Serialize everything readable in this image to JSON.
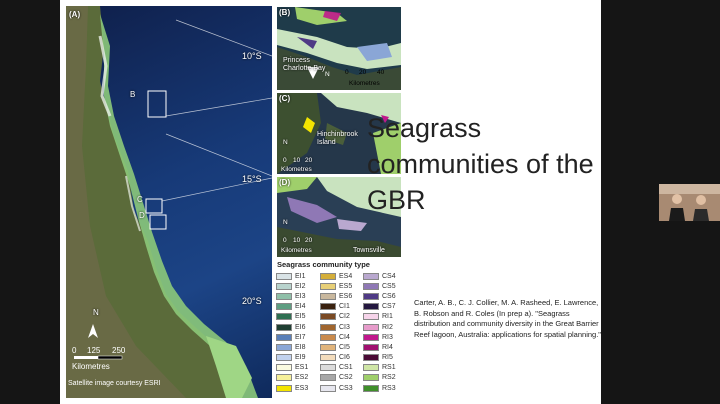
{
  "slide": {
    "title": "Seagrass communities of the GBR",
    "citation": "Carter, A. B., C. J. Collier, M. A. Rasheed, E. Lawrence, B. Robson and R. Coles (In prep a). \"Seagrass distribution and community diversity in the Great Barrier Reef lagoon, Australia: applications for spatial planning.\""
  },
  "figure": {
    "panel_a": {
      "label": "(A)",
      "latitudes": [
        "10°S",
        "15°S",
        "20°S"
      ],
      "box_labels": [
        "B",
        "C",
        "D"
      ],
      "scale_ticks": [
        "0",
        "125",
        "250"
      ],
      "scale_unit": "Kilometres",
      "credit": "Satellite image courtesy ESRI",
      "north": "N"
    },
    "panel_b": {
      "label": "(B)",
      "place": "Princess Charlotte Bay",
      "scale_ticks": [
        "0",
        "20",
        "40"
      ],
      "scale_unit": "Kilometres",
      "north": "N"
    },
    "panel_c": {
      "label": "(C)",
      "place": "Hinchinbrook Island",
      "scale_ticks": [
        "0",
        "10",
        "20"
      ],
      "scale_unit": "Kilometres",
      "north": "N"
    },
    "panel_d": {
      "label": "(D)",
      "place": "Townsville",
      "scale_ticks": [
        "0",
        "10",
        "20"
      ],
      "scale_unit": "Kilometres",
      "north": "N"
    }
  },
  "legend": {
    "title": "Seagrass community type",
    "columns": [
      [
        {
          "label": "EI1",
          "color": "#d9e3e6"
        },
        {
          "label": "EI2",
          "color": "#b8d3cd"
        },
        {
          "label": "EI3",
          "color": "#8fbfa8"
        },
        {
          "label": "EI4",
          "color": "#5f9e82"
        },
        {
          "label": "EI5",
          "color": "#2f6f52"
        },
        {
          "label": "EI6",
          "color": "#1f3f33"
        },
        {
          "label": "EI7",
          "color": "#5a7fb8"
        },
        {
          "label": "EI8",
          "color": "#8aa6d6"
        },
        {
          "label": "EI9",
          "color": "#c2d2ee"
        },
        {
          "label": "ES1",
          "color": "#fbfbe0"
        },
        {
          "label": "ES2",
          "color": "#f6f09a"
        },
        {
          "label": "ES3",
          "color": "#f3e400"
        }
      ],
      [
        {
          "label": "ES4",
          "color": "#d4ae3a"
        },
        {
          "label": "ES5",
          "color": "#e7cf77"
        },
        {
          "label": "ES6",
          "color": "#c9b89e"
        },
        {
          "label": "CI1",
          "color": "#3a2210"
        },
        {
          "label": "CI2",
          "color": "#7a4a24"
        },
        {
          "label": "CI3",
          "color": "#a0652e"
        },
        {
          "label": "CI4",
          "color": "#c98a4c"
        },
        {
          "label": "CI5",
          "color": "#e0b47c"
        },
        {
          "label": "CI6",
          "color": "#f3dcbc"
        },
        {
          "label": "CS1",
          "color": "#dcdcdc"
        },
        {
          "label": "CS2",
          "color": "#a7a7a7"
        },
        {
          "label": "CS3",
          "color": "#e7e7ef"
        }
      ],
      [
        {
          "label": "CS4",
          "color": "#b9a8cf"
        },
        {
          "label": "CS5",
          "color": "#8f78b5"
        },
        {
          "label": "CS6",
          "color": "#4f3a85"
        },
        {
          "label": "CS7",
          "color": "#23173f"
        },
        {
          "label": "RI1",
          "color": "#f6d4ea"
        },
        {
          "label": "RI2",
          "color": "#e79ccb"
        },
        {
          "label": "RI3",
          "color": "#c0188c"
        },
        {
          "label": "RI4",
          "color": "#a0106f"
        },
        {
          "label": "RI5",
          "color": "#4a0a35"
        },
        {
          "label": "RS1",
          "color": "#cfe6a6"
        },
        {
          "label": "RS2",
          "color": "#9fcf6b"
        },
        {
          "label": "RS3",
          "color": "#3f8f2a"
        }
      ]
    ]
  }
}
